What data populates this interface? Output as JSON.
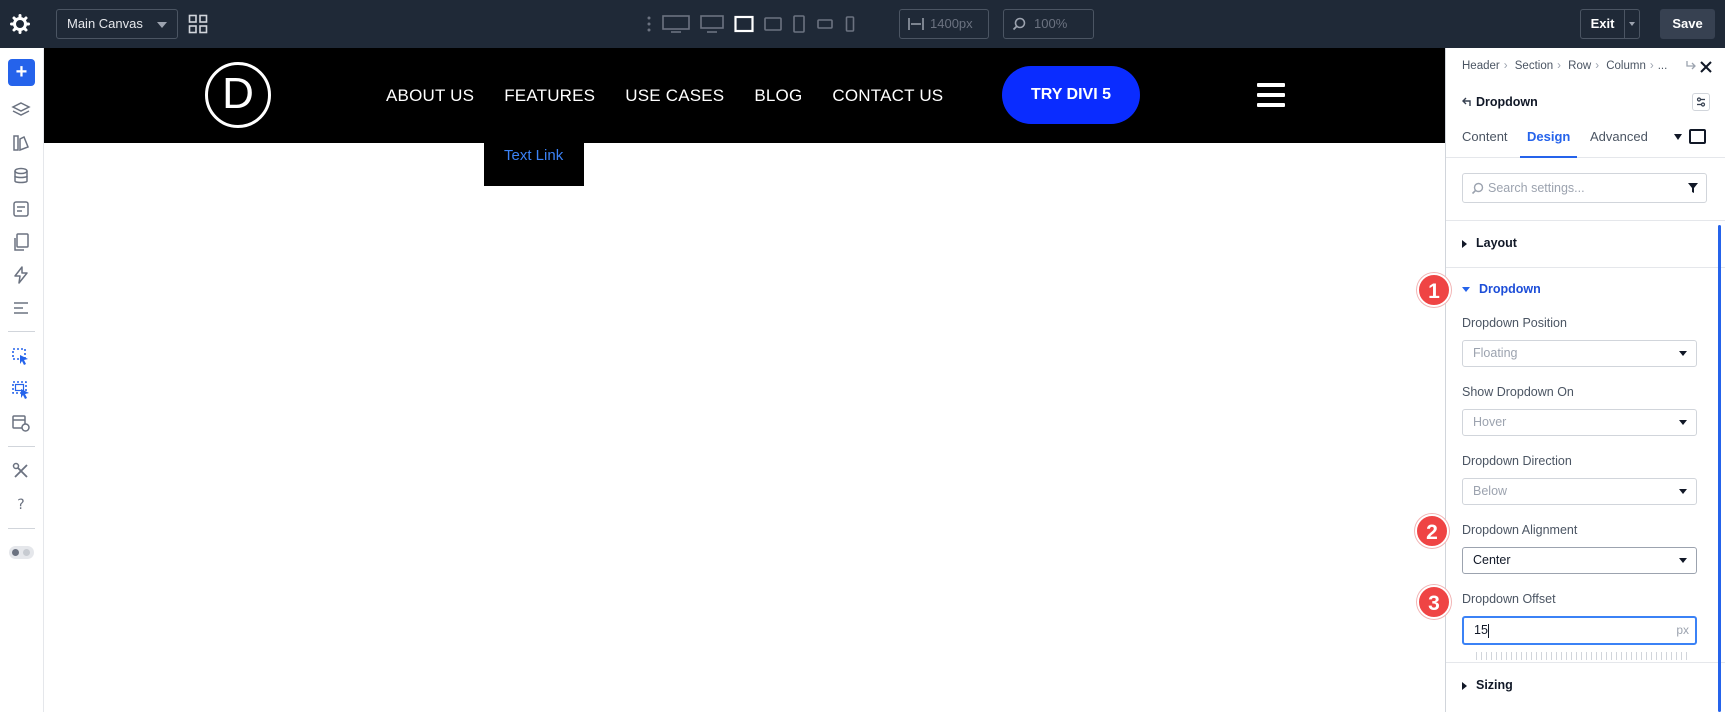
{
  "toolbar": {
    "canvas_select": "Main Canvas",
    "width_value": "1400px",
    "zoom_value": "100%",
    "exit_label": "Exit",
    "save_label": "Save"
  },
  "site": {
    "logo_letter": "D",
    "nav": [
      "ABOUT US",
      "FEATURES",
      "USE CASES",
      "BLOG",
      "CONTACT US"
    ],
    "cta_label": "TRY DIVI 5",
    "dropdown_item": "Text Link"
  },
  "panel": {
    "breadcrumb": [
      "Header",
      "Section",
      "Row",
      "Column",
      "..."
    ],
    "module_title": "Dropdown",
    "tabs": [
      "Content",
      "Design",
      "Advanced"
    ],
    "active_tab": "Design",
    "search_placeholder": "Search settings...",
    "groups": {
      "layout": "Layout",
      "dropdown": "Dropdown",
      "sizing": "Sizing"
    },
    "fields": {
      "position": {
        "label": "Dropdown Position",
        "value": "Floating"
      },
      "show_on": {
        "label": "Show Dropdown On",
        "value": "Hover"
      },
      "direction": {
        "label": "Dropdown Direction",
        "value": "Below"
      },
      "alignment": {
        "label": "Dropdown Alignment",
        "value": "Center"
      },
      "offset": {
        "label": "Dropdown Offset",
        "value": "15",
        "unit": "px"
      }
    }
  },
  "annotations": [
    "1",
    "2",
    "3"
  ],
  "colors": {
    "accent": "#2563eb",
    "toolbar_bg": "#1f2937",
    "cta_bg": "#0a2cff",
    "badge": "#ef4444"
  }
}
